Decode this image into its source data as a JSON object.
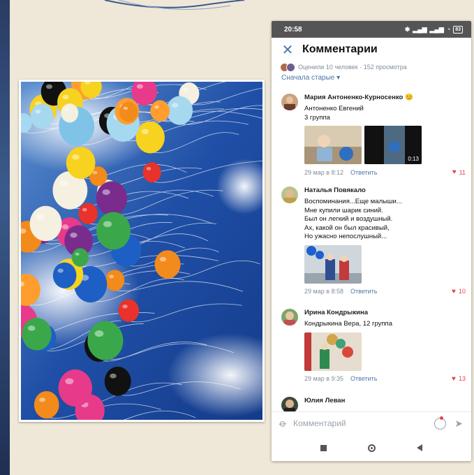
{
  "status": {
    "time": "20:58",
    "battery": "83"
  },
  "header": {
    "title": "Комментарии"
  },
  "rated": {
    "text": "Оценили 10 человек · 152 просмотра"
  },
  "older_link": "Сначала старые ▾",
  "comments": [
    {
      "author": "Мария Антоненко-Курносенко 😊",
      "text": "Антоненко Евгений\n3 группа",
      "video_duration": "0:13",
      "date": "29 мар в 8:12",
      "reply": "Ответить",
      "likes": "11"
    },
    {
      "author": "Наталья Повякало",
      "text": "Воспоминания...Еще малыши...\nМне купили шарик синий.\nБыл он легкий и воздушный.\nАх, какой он был красивый,\nНо ужасно непослушный...",
      "date": "29 мар в 8:58",
      "reply": "Ответить",
      "likes": "10"
    },
    {
      "author": "Ирина Кондрыкина",
      "text": "Кондрыкина Вера, 12 группа",
      "date": "29 мар в 9:35",
      "reply": "Ответить",
      "likes": "13"
    },
    {
      "author": "Юлия Леван",
      "text": ""
    }
  ],
  "composer": {
    "placeholder": "Комментарий"
  },
  "colors": {
    "accent": "#4a76a8",
    "like": "#e64646",
    "background": "#efe8d8"
  },
  "icons": [
    "close-icon",
    "attach-icon",
    "emoji-icon",
    "send-icon",
    "heart-icon"
  ]
}
